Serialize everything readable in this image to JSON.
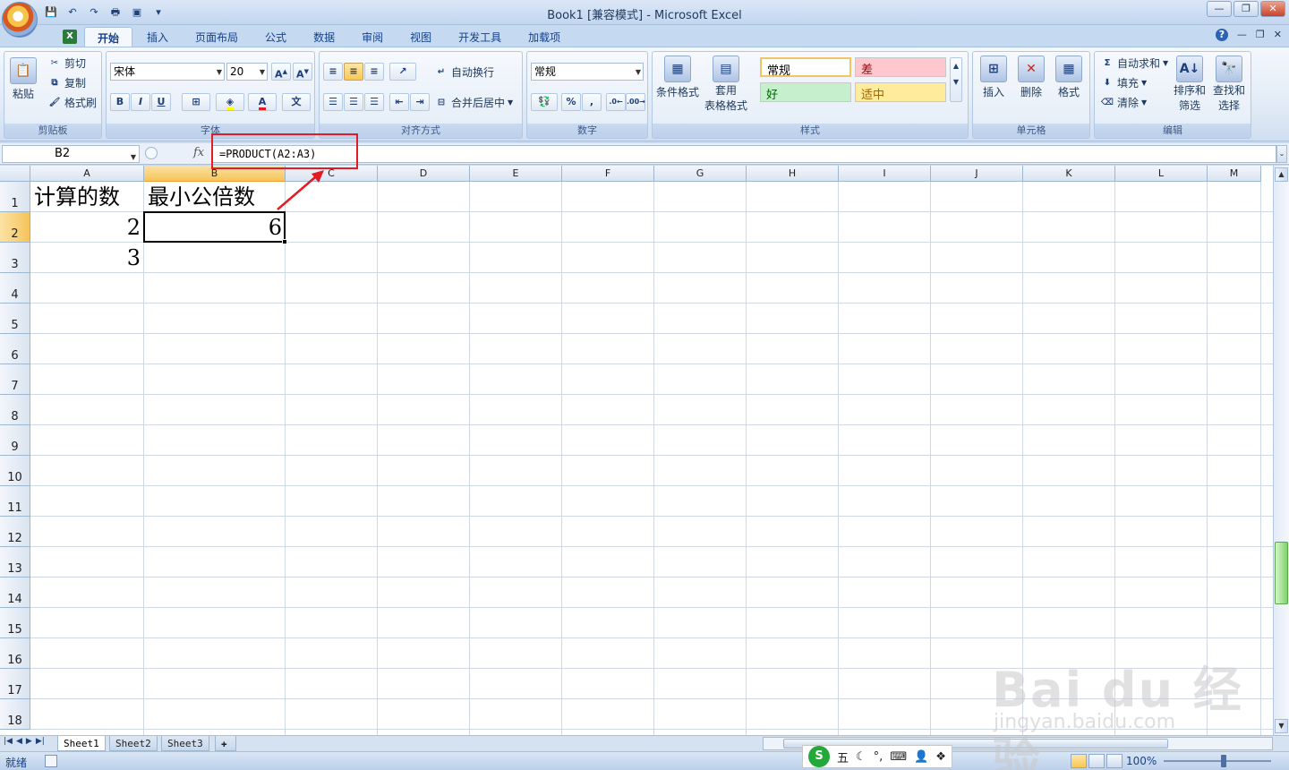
{
  "window": {
    "title": "Book1  [兼容模式] - Microsoft Excel",
    "controls": [
      "—",
      "❐",
      "✕"
    ]
  },
  "qat": {
    "save_icon": "save-icon",
    "undo_icon": "undo-icon",
    "redo_icon": "redo-icon"
  },
  "ribbon_tabs": [
    "开始",
    "插入",
    "页面布局",
    "公式",
    "数据",
    "审阅",
    "视图",
    "开发工具",
    "加载项"
  ],
  "ribbon_tab_icon": "excel-icon",
  "ribbon_right": [
    "?",
    "—",
    "❐",
    "✕"
  ],
  "groups": {
    "clipboard": {
      "label": "剪贴板",
      "paste": "粘贴",
      "cut": "剪切",
      "copy": "复制",
      "format_painter": "格式刷"
    },
    "font": {
      "label": "字体",
      "font_name": "宋体",
      "font_size": "20",
      "bold": "B",
      "italic": "I",
      "underline": "U"
    },
    "alignment": {
      "label": "对齐方式",
      "wrap": "自动换行",
      "merge": "合并后居中"
    },
    "number": {
      "label": "数字",
      "format": "常规",
      "percent": "%",
      "comma": ","
    },
    "styles": {
      "label": "样式",
      "conditional": "条件格式",
      "table_format_1": "套用",
      "table_format_2": "表格格式",
      "normal": "常规",
      "bad": "差",
      "good": "好",
      "neutral": "适中"
    },
    "cells": {
      "label": "单元格",
      "insert": "插入",
      "delete": "删除",
      "format": "格式"
    },
    "editing": {
      "label": "编辑",
      "autosum": "自动求和",
      "fill": "填充",
      "clear": "清除",
      "sort_1": "排序和",
      "sort_2": "筛选",
      "find_1": "查找和",
      "find_2": "选择"
    }
  },
  "formula_bar": {
    "name_box": "B2",
    "fx": "fx",
    "formula": "=PRODUCT(A2:A3)"
  },
  "columns": [
    "A",
    "B",
    "C",
    "D",
    "E",
    "F",
    "G",
    "H",
    "I",
    "J",
    "K",
    "L",
    "M"
  ],
  "rows": [
    "1",
    "2",
    "3",
    "4",
    "5",
    "6",
    "7",
    "8",
    "9",
    "10",
    "11",
    "12",
    "13",
    "14",
    "15",
    "16",
    "17",
    "18"
  ],
  "cells": {
    "A1": "计算的数",
    "B1": "最小公倍数",
    "A2": "2",
    "B2": "6",
    "A3": "3"
  },
  "selected_cell": "B2",
  "sheets": [
    "Sheet1",
    "Sheet2",
    "Sheet3"
  ],
  "active_sheet": "Sheet1",
  "status": {
    "ready": "就绪",
    "zoom": "100%",
    "ime": [
      "五",
      "☾",
      "°,",
      "⌨",
      "👤",
      "❖"
    ]
  },
  "watermark": {
    "brand": "Bai du 经验",
    "url": "jingyan.baidu.com"
  },
  "colors": {
    "accent": "#15428b",
    "highlight_red": "#e31b23",
    "style_bad_bg": "#ffc7ce",
    "style_good_bg": "#c6efce",
    "style_neutral_bg": "#ffeb9c"
  }
}
